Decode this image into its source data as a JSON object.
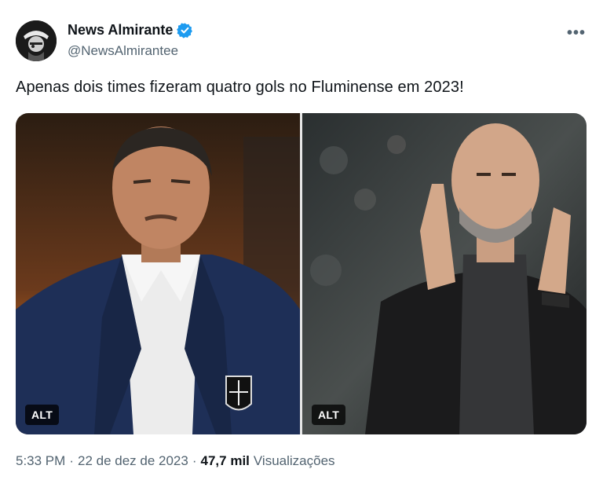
{
  "author": {
    "display_name": "News Almirante",
    "handle": "@NewsAlmirantee",
    "verified": true,
    "avatar_icon": "pirate-avatar-icon"
  },
  "more_label": "•••",
  "tweet": {
    "text": "Apenas dois times fizeram quatro gols no Fluminense em 2023!"
  },
  "media": {
    "photos": [
      {
        "alt_label": "ALT"
      },
      {
        "alt_label": "ALT"
      }
    ]
  },
  "meta": {
    "time": "5:33 PM",
    "date": "22 de dez de 2023",
    "separator": "·",
    "views_count": "47,7 mil",
    "views_label": "Visualizações"
  },
  "colors": {
    "verified_blue": "#1d9bf0",
    "secondary_text": "#536471",
    "primary_text": "#0f1419"
  }
}
